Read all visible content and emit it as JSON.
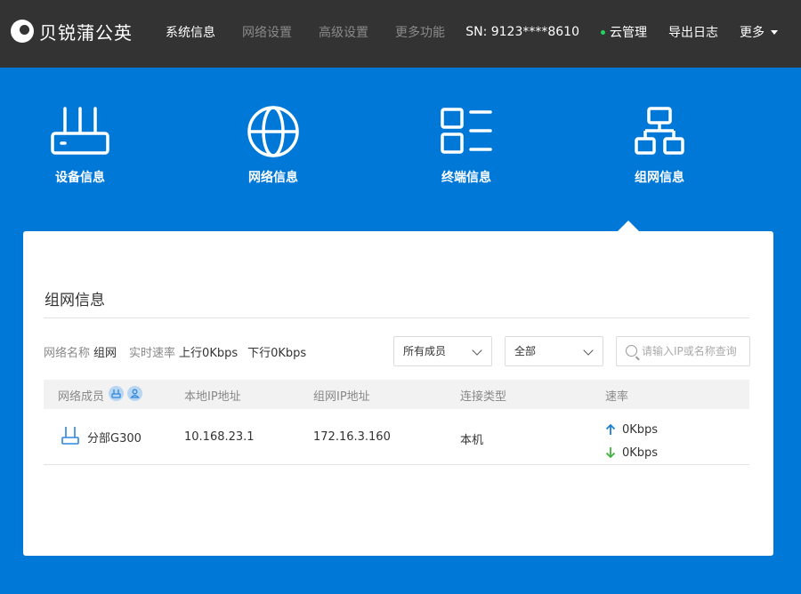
{
  "brand": {
    "name": "贝锐蒲公英"
  },
  "nav": {
    "items": [
      {
        "label": "系统信息",
        "active": true
      },
      {
        "label": "网络设置",
        "active": false
      },
      {
        "label": "高级设置",
        "active": false
      },
      {
        "label": "更多功能",
        "active": false
      }
    ]
  },
  "header": {
    "sn": "SN:  9123****8610",
    "cloud": "云管理",
    "export": "导出日志",
    "more": "更多"
  },
  "categories": [
    {
      "label": "设备信息",
      "icon": "router-icon"
    },
    {
      "label": "网络信息",
      "icon": "globe-icon"
    },
    {
      "label": "终端信息",
      "icon": "list-icon"
    },
    {
      "label": "组网信息",
      "icon": "network-icon",
      "selected": true
    }
  ],
  "panel": {
    "title": "组网信息",
    "filters": {
      "network_name_label": "网络名称",
      "network_name": "组网",
      "realtime_label": "实时速率",
      "upload": "上行0Kbps",
      "download": "下行0Kbps"
    },
    "member_select": "所有成员",
    "type_select": "全部",
    "search_placeholder": "请输入IP或名称查询",
    "table": {
      "headers": [
        "网络成员",
        "本地IP地址",
        "组网IP地址",
        "连接类型",
        "速率"
      ],
      "rows": [
        {
          "name": "分部G300",
          "local_ip": "10.168.23.1",
          "network_ip": "172.16.3.160",
          "type": "本机",
          "up": "0Kbps",
          "down": "0Kbps"
        }
      ]
    }
  },
  "colors": {
    "topbar": "#333333",
    "accent_blue": "#0078d7",
    "online_green": "#23d160",
    "up_arrow": "#1a7fd4",
    "down_arrow": "#3cb43c"
  }
}
